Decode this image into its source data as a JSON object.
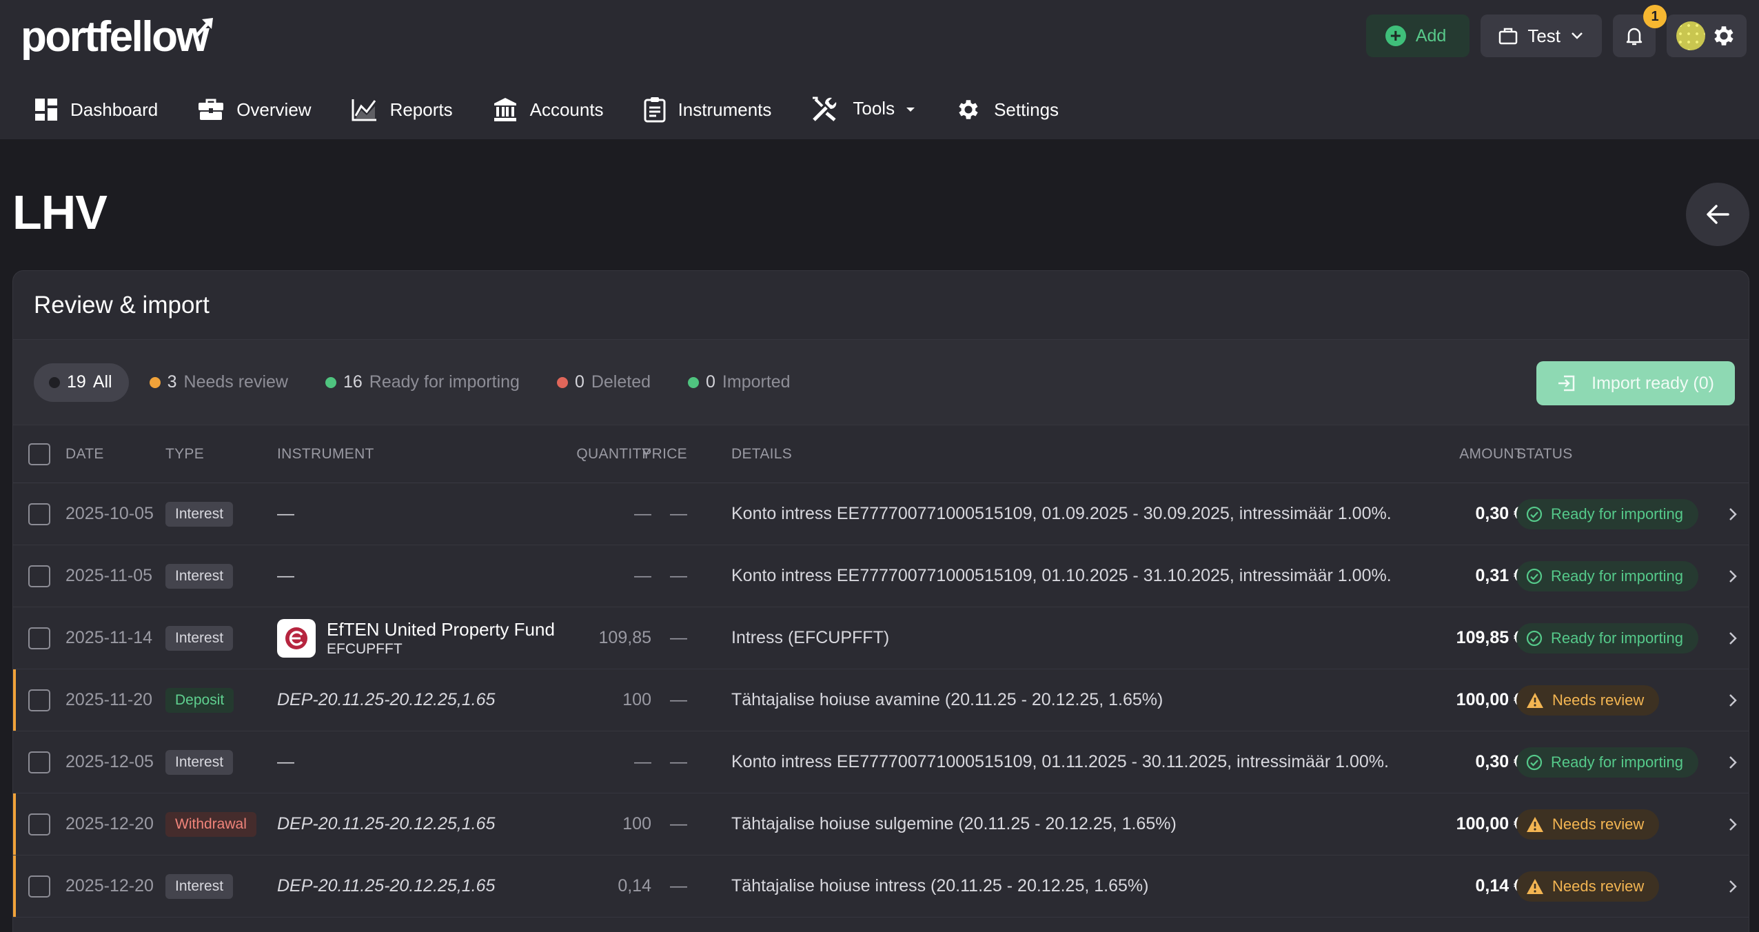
{
  "app": {
    "logo_text": "portfellow",
    "add_label": "Add",
    "portfolio_label": "Test",
    "notification_count": "1"
  },
  "nav": [
    {
      "label": "Dashboard",
      "icon": "dashboard-icon"
    },
    {
      "label": "Overview",
      "icon": "briefcase-icon"
    },
    {
      "label": "Reports",
      "icon": "chart-line-icon"
    },
    {
      "label": "Accounts",
      "icon": "bank-icon"
    },
    {
      "label": "Instruments",
      "icon": "clipboard-icon"
    },
    {
      "label": "Tools",
      "icon": "tools-icon"
    },
    {
      "label": "Settings",
      "icon": "gear-icon"
    }
  ],
  "page": {
    "title": "LHV"
  },
  "card": {
    "title": "Review & import",
    "import_button": "Import ready (0)"
  },
  "filters": [
    {
      "count": "19",
      "label": "All",
      "color": "#1f1f24",
      "active": true
    },
    {
      "count": "3",
      "label": "Needs review",
      "color": "#f1a33a",
      "active": false
    },
    {
      "count": "16",
      "label": "Ready for importing",
      "color": "#4fc47f",
      "active": false
    },
    {
      "count": "0",
      "label": "Deleted",
      "color": "#e0665a",
      "active": false
    },
    {
      "count": "0",
      "label": "Imported",
      "color": "#4fc47f",
      "active": false
    }
  ],
  "columns": {
    "date": "DATE",
    "type": "TYPE",
    "instrument": "INSTRUMENT",
    "quantity": "QUANTITY",
    "price": "PRICE",
    "details": "DETAILS",
    "amount": "AMOUNT",
    "status": "STATUS"
  },
  "rows": [
    {
      "date": "2025-10-05",
      "type": "Interest",
      "type_style": "neutral",
      "instrument": "—",
      "quantity": "—",
      "price": "—",
      "details": "Konto intress EE777700771000515109, 01.09.2025 - 30.09.2025, intressimäär 1.00%.",
      "amount": "0,30 €",
      "status": "Ready for importing"
    },
    {
      "date": "2025-11-05",
      "type": "Interest",
      "type_style": "neutral",
      "instrument": "—",
      "quantity": "—",
      "price": "—",
      "details": "Konto intress EE777700771000515109, 01.10.2025 - 31.10.2025, intressimäär 1.00%.",
      "amount": "0,31 €",
      "status": "Ready for importing"
    },
    {
      "date": "2025-11-14",
      "type": "Interest",
      "type_style": "neutral",
      "instrument": "EfTEN United Property Fund",
      "ticker": "EFCUPFFT",
      "quantity": "109,85",
      "price": "—",
      "details": "Intress (EFCUPFFT)",
      "amount": "109,85 €",
      "status": "Ready for importing"
    },
    {
      "date": "2025-11-20",
      "type": "Deposit",
      "type_style": "green",
      "instrument": "DEP-20.11.25-20.12.25,1.65",
      "quantity": "100",
      "price": "—",
      "details": "Tähtajalise hoiuse avamine (20.11.25 - 20.12.25, 1.65%)",
      "amount": "100,00 €",
      "status": "Needs review"
    },
    {
      "date": "2025-12-05",
      "type": "Interest",
      "type_style": "neutral",
      "instrument": "—",
      "quantity": "—",
      "price": "—",
      "details": "Konto intress EE777700771000515109, 01.11.2025 - 30.11.2025, intressimäär 1.00%.",
      "amount": "0,30 €",
      "status": "Ready for importing"
    },
    {
      "date": "2025-12-20",
      "type": "Withdrawal",
      "type_style": "red",
      "instrument": "DEP-20.11.25-20.12.25,1.65",
      "quantity": "100",
      "price": "—",
      "details": "Tähtajalise hoiuse sulgemine (20.11.25 - 20.12.25, 1.65%)",
      "amount": "100,00 €",
      "status": "Needs review"
    },
    {
      "date": "2025-12-20",
      "type": "Interest",
      "type_style": "neutral",
      "instrument": "DEP-20.11.25-20.12.25,1.65",
      "quantity": "0,14",
      "price": "—",
      "details": "Tähtajalise hoiuse intress (20.11.25 - 20.12.25, 1.65%)",
      "amount": "0,14 €",
      "status": "Needs review"
    }
  ]
}
